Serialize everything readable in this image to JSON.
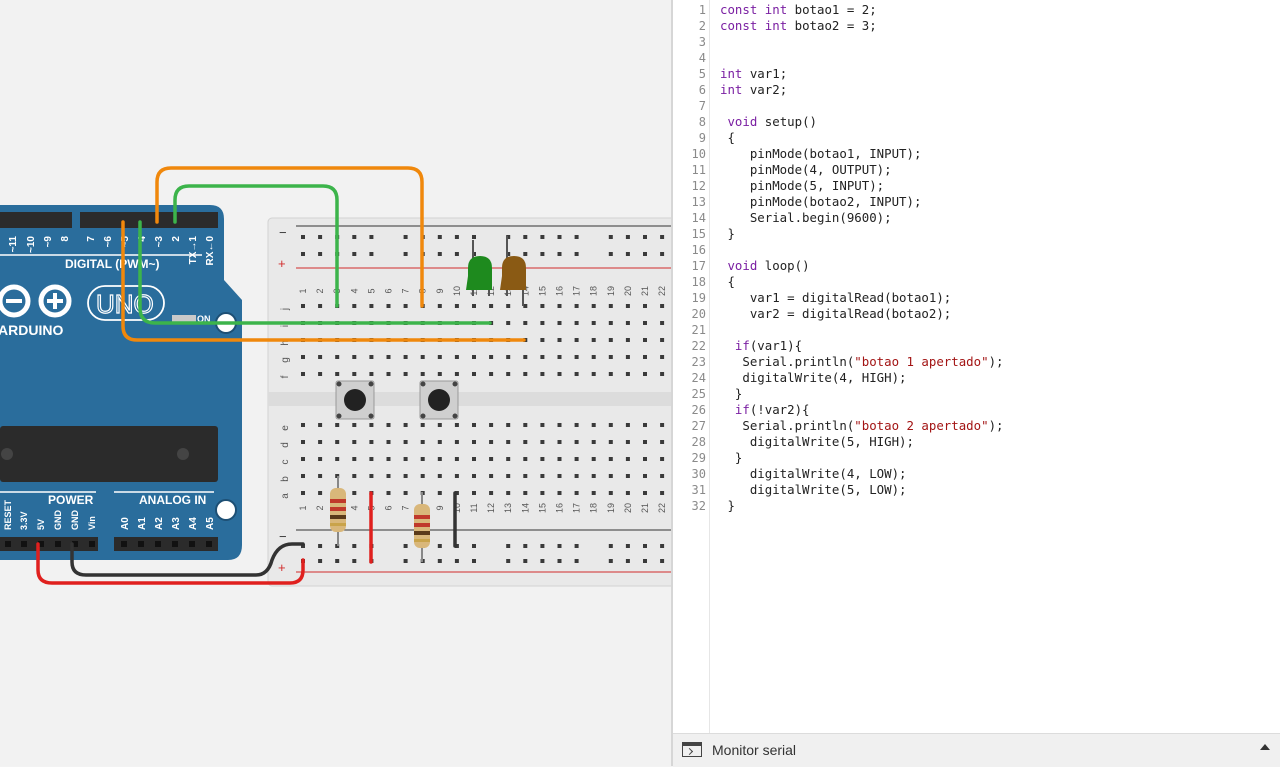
{
  "board": {
    "brand": "ARDUINO",
    "model": "UNO",
    "on_label": "ON",
    "digital_label": "DIGITAL (PWM~)",
    "power_label": "POWER",
    "analog_label": "ANALOG IN",
    "digital_pins": [
      "~11",
      "~10",
      "~9",
      "8",
      "7",
      "~6",
      "~5",
      "4",
      "~3",
      "2",
      "TX→1",
      "RX←0"
    ],
    "power_pins": [
      "RESET",
      "3.3V",
      "5V",
      "GND",
      "GND",
      "Vin"
    ],
    "analog_pins": [
      "A0",
      "A1",
      "A2",
      "A3",
      "A4",
      "A5"
    ],
    "color": "#2a6d9c"
  },
  "breadboard": {
    "rail_minus": "−",
    "rail_plus": "+",
    "row_letters_top": [
      "j",
      "i",
      "h",
      "g",
      "f"
    ],
    "row_letters_bottom": [
      "e",
      "d",
      "c",
      "b",
      "a"
    ],
    "column_numbers": [
      "1",
      "2",
      "3",
      "4",
      "5",
      "6",
      "7",
      "8",
      "9",
      "10",
      "11",
      "12",
      "13",
      "14",
      "15",
      "16",
      "17",
      "18",
      "19",
      "20",
      "21",
      "22"
    ]
  },
  "components": {
    "led_colors": [
      "#1e8a1e",
      "#8a5a14"
    ],
    "wire_colors": {
      "orange": "#f0880c",
      "green": "#3cb44b",
      "red": "#e0201e",
      "black": "#333333"
    }
  },
  "editor": {
    "lines": [
      "const int botao1 = 2;",
      "const int botao2 = 3;",
      "",
      "",
      "int var1;",
      "int var2;",
      "",
      " void setup()",
      " {",
      "    pinMode(botao1, INPUT);",
      "    pinMode(4, OUTPUT);",
      "    pinMode(5, INPUT);",
      "    pinMode(botao2, INPUT);",
      "    Serial.begin(9600);",
      " }",
      "",
      " void loop()",
      " {",
      "    var1 = digitalRead(botao1);",
      "    var2 = digitalRead(botao2);",
      "",
      "  if(var1){",
      "   Serial.println(\"botao 1 apertado\");",
      "   digitalWrite(4, HIGH);",
      "  }",
      "  if(!var2){",
      "   Serial.println(\"botao 2 apertado\");",
      "    digitalWrite(5, HIGH);",
      "  }",
      "    digitalWrite(4, LOW);",
      "    digitalWrite(5, LOW);",
      " }"
    ]
  },
  "serial_monitor": {
    "label": "Monitor serial",
    "icon": "serial-monitor-icon",
    "toggle_icon": "caret-up-icon"
  }
}
